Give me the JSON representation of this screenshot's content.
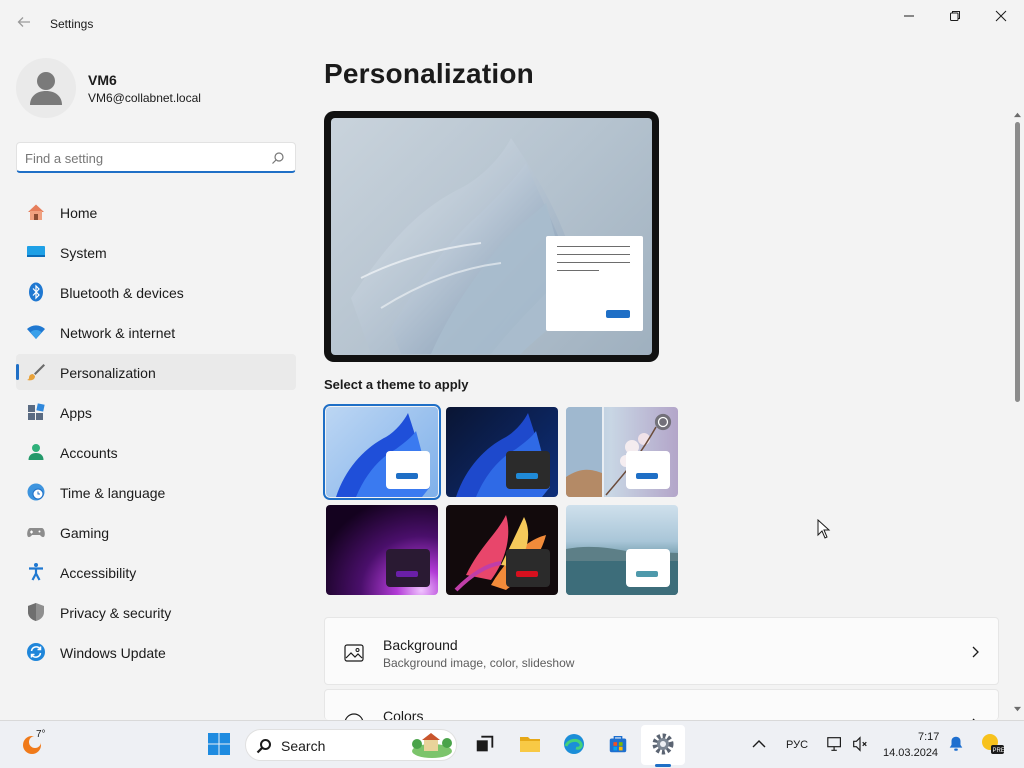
{
  "window": {
    "title": "Settings"
  },
  "profile": {
    "name": "VM6",
    "email": "VM6@collabnet.local"
  },
  "search": {
    "placeholder": "Find a setting"
  },
  "nav": [
    {
      "label": "Home",
      "icon": "home-icon"
    },
    {
      "label": "System",
      "icon": "system-icon"
    },
    {
      "label": "Bluetooth & devices",
      "icon": "bluetooth-icon"
    },
    {
      "label": "Network & internet",
      "icon": "wifi-icon"
    },
    {
      "label": "Personalization",
      "icon": "brush-icon",
      "active": true
    },
    {
      "label": "Apps",
      "icon": "apps-icon"
    },
    {
      "label": "Accounts",
      "icon": "accounts-icon"
    },
    {
      "label": "Time & language",
      "icon": "clock-globe-icon"
    },
    {
      "label": "Gaming",
      "icon": "gamepad-icon"
    },
    {
      "label": "Accessibility",
      "icon": "accessibility-icon"
    },
    {
      "label": "Privacy & security",
      "icon": "shield-icon"
    },
    {
      "label": "Windows Update",
      "icon": "update-icon"
    }
  ],
  "main": {
    "title": "Personalization",
    "themes_label": "Select a theme to apply",
    "themes": [
      {
        "name": "windows-light",
        "selected": true
      },
      {
        "name": "windows-dark"
      },
      {
        "name": "spotlight"
      },
      {
        "name": "glow"
      },
      {
        "name": "captured-motion"
      },
      {
        "name": "flow"
      }
    ],
    "cards": [
      {
        "title": "Background",
        "subtitle": "Background image, color, slideshow",
        "icon": "picture-icon"
      },
      {
        "title": "Colors",
        "subtitle": "",
        "icon": "palette-icon"
      }
    ]
  },
  "taskbar": {
    "weather_temp": "7°",
    "search_label": "Search",
    "language": "РУС",
    "time": "7:17",
    "date": "14.03.2024"
  },
  "colors": {
    "accent": "#1f6fc6"
  }
}
